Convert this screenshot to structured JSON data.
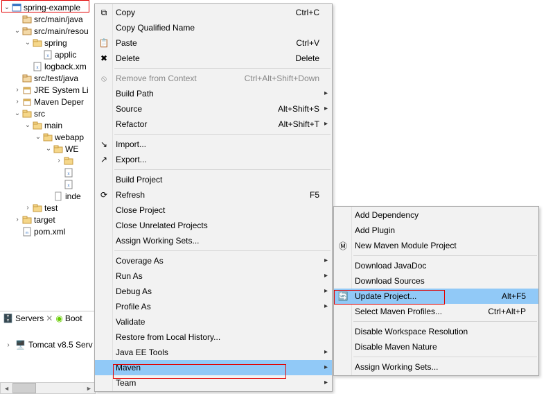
{
  "tree": {
    "root": "spring-example",
    "nodes": [
      {
        "depth": 0,
        "tw": "open",
        "icon": "proj",
        "label": "spring-example"
      },
      {
        "depth": 1,
        "tw": "none",
        "icon": "pkg",
        "label": "src/main/java"
      },
      {
        "depth": 1,
        "tw": "open",
        "icon": "pkg",
        "label": "src/main/resou"
      },
      {
        "depth": 2,
        "tw": "open",
        "icon": "folder-o",
        "label": "spring"
      },
      {
        "depth": 3,
        "tw": "none",
        "icon": "xml",
        "label": "applic"
      },
      {
        "depth": 2,
        "tw": "none",
        "icon": "xml",
        "label": "logback.xm"
      },
      {
        "depth": 1,
        "tw": "none",
        "icon": "pkg",
        "label": "src/test/java"
      },
      {
        "depth": 1,
        "tw": "closed",
        "icon": "lib",
        "label": "JRE System Li"
      },
      {
        "depth": 1,
        "tw": "closed",
        "icon": "lib",
        "label": "Maven Deper"
      },
      {
        "depth": 1,
        "tw": "open",
        "icon": "folder",
        "label": "src"
      },
      {
        "depth": 2,
        "tw": "open",
        "icon": "folder",
        "label": "main"
      },
      {
        "depth": 3,
        "tw": "open",
        "icon": "folder-o",
        "label": "webapp"
      },
      {
        "depth": 4,
        "tw": "open",
        "icon": "folder-o",
        "label": "WE"
      },
      {
        "depth": 5,
        "tw": "closed",
        "icon": "folder-o",
        "label": ""
      },
      {
        "depth": 5,
        "tw": "none",
        "icon": "xml",
        "label": ""
      },
      {
        "depth": 5,
        "tw": "none",
        "icon": "xml",
        "label": ""
      },
      {
        "depth": 4,
        "tw": "none",
        "icon": "file",
        "label": "inde"
      },
      {
        "depth": 2,
        "tw": "closed",
        "icon": "folder",
        "label": "test"
      },
      {
        "depth": 1,
        "tw": "closed",
        "icon": "folder",
        "label": "target"
      },
      {
        "depth": 1,
        "tw": "none",
        "icon": "pom",
        "label": "pom.xml"
      }
    ]
  },
  "views": {
    "servers_tab": "Servers",
    "boot_tab": "Boot",
    "tomcat": "Tomcat v8.5 Serv"
  },
  "context_menu": [
    {
      "icon": "copy",
      "label": "Copy",
      "shortcut": "Ctrl+C"
    },
    {
      "label": "Copy Qualified Name"
    },
    {
      "icon": "paste",
      "label": "Paste",
      "shortcut": "Ctrl+V"
    },
    {
      "icon": "delete",
      "label": "Delete",
      "shortcut": "Delete"
    },
    {
      "sep": true
    },
    {
      "icon": "remove",
      "label": "Remove from Context",
      "shortcut": "Ctrl+Alt+Shift+Down",
      "disabled": true
    },
    {
      "label": "Build Path",
      "sub": true
    },
    {
      "label": "Source",
      "shortcut": "Alt+Shift+S",
      "sub": true
    },
    {
      "label": "Refactor",
      "shortcut": "Alt+Shift+T",
      "sub": true
    },
    {
      "sep": true
    },
    {
      "icon": "import",
      "label": "Import..."
    },
    {
      "icon": "export",
      "label": "Export..."
    },
    {
      "sep": true
    },
    {
      "label": "Build Project"
    },
    {
      "icon": "refresh",
      "label": "Refresh",
      "shortcut": "F5"
    },
    {
      "label": "Close Project"
    },
    {
      "label": "Close Unrelated Projects"
    },
    {
      "label": "Assign Working Sets..."
    },
    {
      "sep": true
    },
    {
      "label": "Coverage As",
      "sub": true
    },
    {
      "label": "Run As",
      "sub": true
    },
    {
      "label": "Debug As",
      "sub": true
    },
    {
      "label": "Profile As",
      "sub": true
    },
    {
      "label": "Validate"
    },
    {
      "label": "Restore from Local History..."
    },
    {
      "label": "Java EE Tools",
      "sub": true
    },
    {
      "label": "Maven",
      "sub": true,
      "selected": true
    },
    {
      "label": "Team",
      "sub": true
    }
  ],
  "maven_submenu": [
    {
      "label": "Add Dependency"
    },
    {
      "label": "Add Plugin"
    },
    {
      "icon": "newmvn",
      "label": "New Maven Module Project"
    },
    {
      "sep": true
    },
    {
      "label": "Download JavaDoc"
    },
    {
      "label": "Download Sources"
    },
    {
      "icon": "update",
      "label": "Update Project...",
      "shortcut": "Alt+F5",
      "selected": true
    },
    {
      "label": "Select Maven Profiles...",
      "shortcut": "Ctrl+Alt+P"
    },
    {
      "sep": true
    },
    {
      "label": "Disable Workspace Resolution"
    },
    {
      "label": "Disable Maven Nature"
    },
    {
      "sep": true
    },
    {
      "label": "Assign Working Sets..."
    }
  ]
}
